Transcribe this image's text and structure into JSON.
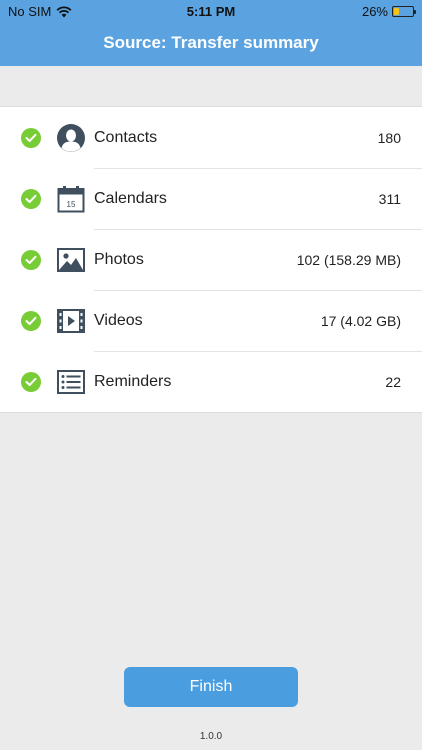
{
  "status_bar": {
    "carrier": "No SIM",
    "time": "5:11 PM",
    "battery_percent": "26%",
    "battery_level": 0.26,
    "battery_color": "#f3c316"
  },
  "header": {
    "title": "Source: Transfer summary",
    "color": "#5aa3e0"
  },
  "items": [
    {
      "label": "Contacts",
      "count": "180",
      "icon": "contact-icon",
      "status": "check-icon"
    },
    {
      "label": "Calendars",
      "count": "311",
      "icon": "calendar-icon",
      "calendar_day": "15",
      "status": "check-icon"
    },
    {
      "label": "Photos",
      "count": "102 (158.29 MB)",
      "icon": "photo-icon",
      "status": "check-icon"
    },
    {
      "label": "Videos",
      "count": "17 (4.02 GB)",
      "icon": "video-icon",
      "status": "check-icon"
    },
    {
      "label": "Reminders",
      "count": "22",
      "icon": "reminders-icon",
      "status": "check-icon"
    }
  ],
  "check_color": "#78cc35",
  "finish_button": {
    "label": "Finish",
    "color": "#4a9ee0"
  },
  "version": "1.0.0"
}
